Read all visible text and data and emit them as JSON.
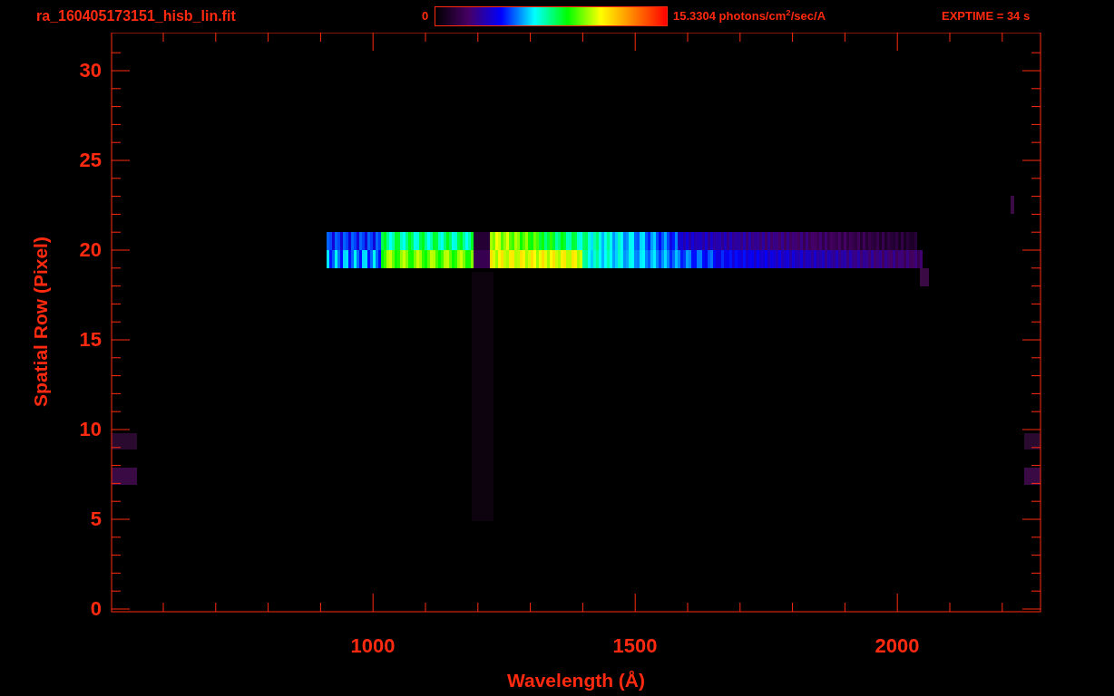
{
  "header": {
    "filename": "ra_160405173151_hisb_lin.fit",
    "colorbar": {
      "min_label": "0",
      "max_label": "15.3304 photons/cm$^{2}$/sec/A"
    },
    "exposure": "EXPTIME = 34 s"
  },
  "plot": {
    "ylabel": "Spatial Row (Pixel)",
    "xlabel": "Wavelength (Å)",
    "yticks": [
      {
        "label": "30"
      },
      {
        "label": "25"
      },
      {
        "label": "20"
      },
      {
        "label": "15"
      },
      {
        "label": "10"
      },
      {
        "label": "5"
      },
      {
        "label": "0"
      }
    ],
    "xticks": [
      {
        "label": "1000"
      },
      {
        "label": "1500"
      },
      {
        "label": "2000"
      }
    ]
  }
}
